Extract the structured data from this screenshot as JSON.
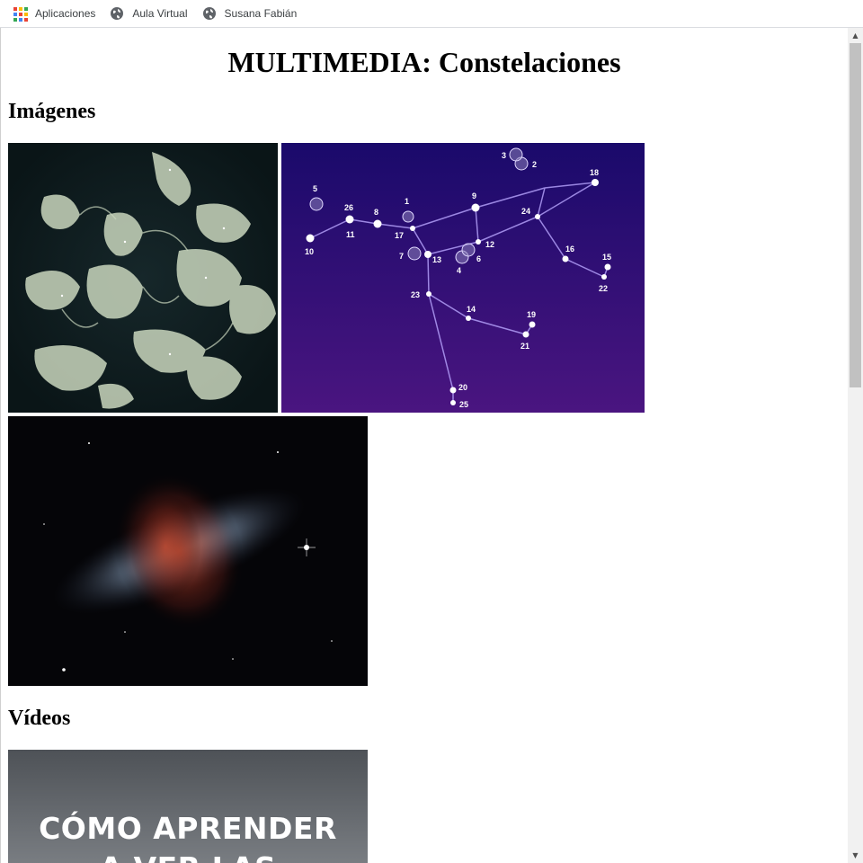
{
  "bookmarks": [
    {
      "label": "Aplicaciones",
      "icon": "apps-grid-icon"
    },
    {
      "label": "Aula Virtual",
      "icon": "globe-icon"
    },
    {
      "label": "Susana Fabián",
      "icon": "globe-icon"
    }
  ],
  "page": {
    "title": "MULTIMEDIA: Constelaciones",
    "sections": {
      "images_heading": "Imágenes",
      "videos_heading": "Vídeos"
    }
  },
  "video": {
    "thumbnail_text_line1": "CÓMO APRENDER",
    "thumbnail_text_line2": "A VER LAS"
  },
  "constellation_labels": [
    "1",
    "2",
    "3",
    "4",
    "5",
    "6",
    "7",
    "8",
    "9",
    "10",
    "11",
    "12",
    "13",
    "14",
    "15",
    "16",
    "17",
    "18",
    "19",
    "20",
    "21",
    "22",
    "23",
    "24",
    "25",
    "26"
  ],
  "colors": {
    "accent_apps": [
      "#ea4335",
      "#fbbc05",
      "#34a853",
      "#4285f4"
    ],
    "atlas_bg": "#0d1a1c",
    "constellation_bg_top": "#1a0a6b",
    "constellation_bg_bottom": "#4a1580",
    "galaxy_bg": "#050508",
    "video_bg": "#6a6e73"
  }
}
